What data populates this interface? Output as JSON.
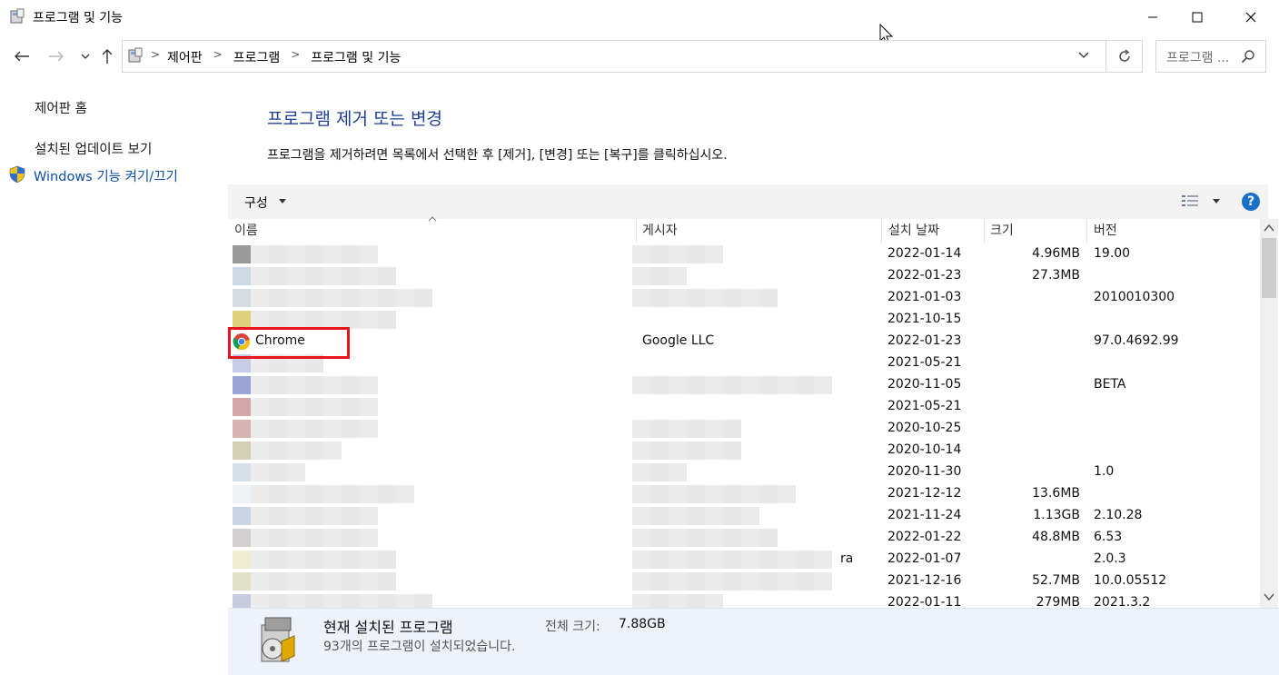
{
  "window": {
    "title": "프로그램 및 기능",
    "icon": "control-panel-icon",
    "controls": {
      "minimize": "minimize-icon",
      "maximize": "maximize-icon",
      "close": "close-icon"
    }
  },
  "nav": {
    "breadcrumb": [
      "제어판",
      "프로그램",
      "프로그램 및 기능"
    ],
    "search_placeholder": "프로그램 ..."
  },
  "sidebar": {
    "home": "제어판 홈",
    "updates": "설치된 업데이트 보기",
    "features": "Windows 기능 켜기/끄기"
  },
  "main": {
    "title": "프로그램 제거 또는 변경",
    "description": "프로그램을 제거하려면 목록에서 선택한 후 [제거], [변경] 또는 [복구]를 클릭하십시오.",
    "organize": "구성",
    "help": "?"
  },
  "table": {
    "columns": [
      "이름",
      "게시자",
      "설치 날짜",
      "크기",
      "버전"
    ],
    "rows": [
      {
        "name": "",
        "publisher": "",
        "date": "2022-01-14",
        "size": "4.96MB",
        "version": "19.00"
      },
      {
        "name": "",
        "publisher": "",
        "date": "2022-01-23",
        "size": "27.3MB",
        "version": ""
      },
      {
        "name": "",
        "publisher": "",
        "date": "2021-01-03",
        "size": "",
        "version": "2010010300"
      },
      {
        "name": "",
        "publisher": "",
        "date": "2021-10-15",
        "size": "",
        "version": ""
      },
      {
        "name": "Chrome",
        "publisher": "Google LLC",
        "date": "2022-01-23",
        "size": "",
        "version": "97.0.4692.99"
      },
      {
        "name": "",
        "publisher": "",
        "date": "2021-05-21",
        "size": "",
        "version": ""
      },
      {
        "name": "",
        "publisher": "",
        "date": "2020-11-05",
        "size": "",
        "version": "BETA"
      },
      {
        "name": "",
        "publisher": "",
        "date": "2021-05-21",
        "size": "",
        "version": ""
      },
      {
        "name": "",
        "publisher": "",
        "date": "2020-10-25",
        "size": "",
        "version": ""
      },
      {
        "name": "",
        "publisher": "",
        "date": "2020-10-14",
        "size": "",
        "version": ""
      },
      {
        "name": "",
        "publisher": "",
        "date": "2020-11-30",
        "size": "",
        "version": "1.0"
      },
      {
        "name": "",
        "publisher": "",
        "date": "2021-12-12",
        "size": "13.6MB",
        "version": ""
      },
      {
        "name": "",
        "publisher": "",
        "date": "2021-11-24",
        "size": "1.13GB",
        "version": "2.10.28"
      },
      {
        "name": "",
        "publisher": "",
        "date": "2022-01-22",
        "size": "48.8MB",
        "version": "6.53"
      },
      {
        "name": "",
        "publisher": "ra",
        "date": "2022-01-07",
        "size": "",
        "version": "2.0.3"
      },
      {
        "name": "",
        "publisher": "",
        "date": "2021-12-16",
        "size": "52.7MB",
        "version": "10.0.05512"
      },
      {
        "name": "",
        "publisher": "",
        "date": "2022-01-11",
        "size": "279MB",
        "version": "2021.3.2"
      }
    ]
  },
  "status": {
    "title": "현재 설치된 프로그램",
    "total_label": "전체 크기:",
    "total_value": "7.88GB",
    "count_text": "93개의 프로그램이 설치되었습니다."
  },
  "colors": {
    "title_blue": "#1f3f95",
    "highlight_red": "#e8141b",
    "status_bg": "#eef3fb",
    "help_blue": "#1a6fc6"
  }
}
